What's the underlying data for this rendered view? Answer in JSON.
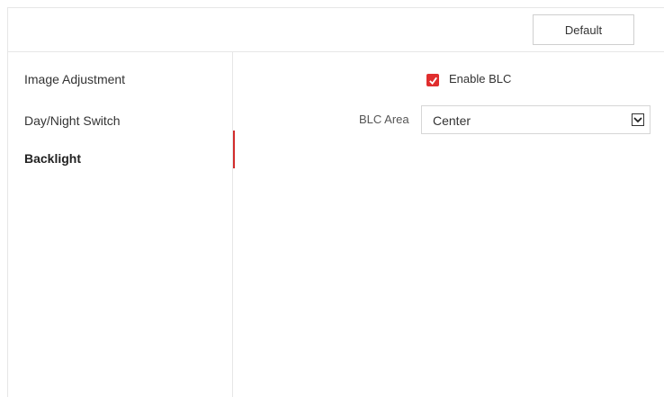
{
  "header": {
    "default_label": "Default"
  },
  "sidebar": {
    "items": [
      {
        "label": "Image Adjustment",
        "active": false
      },
      {
        "label": "Day/Night Switch",
        "active": false
      },
      {
        "label": "Backlight",
        "active": true
      }
    ]
  },
  "main": {
    "enable_blc": {
      "label": "Enable BLC",
      "checked": true
    },
    "blc_area": {
      "label": "BLC Area",
      "value": "Center"
    }
  },
  "colors": {
    "accent": "#e02e2e",
    "border": "#e6e6e6"
  },
  "icons": {
    "checkbox": "checkmark-icon",
    "dropdown": "chevron-down-icon"
  }
}
